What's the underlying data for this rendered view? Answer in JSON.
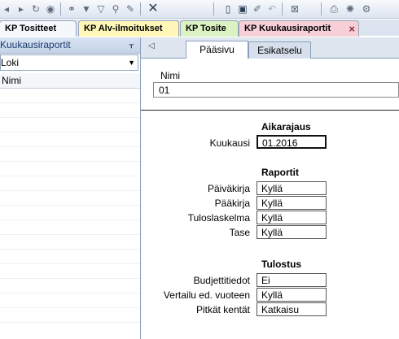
{
  "toolbar": {
    "icons": [
      "arrow-left-icon",
      "arrow-right-icon",
      "refresh-icon",
      "stop-icon",
      "binoculars-icon",
      "filter-icon",
      "filter-clear-icon",
      "zoom-icon",
      "clear-icon",
      "close-icon",
      "new-document-icon",
      "save-icon",
      "edit-icon",
      "undo-icon",
      "delete-icon",
      "print-icon",
      "settings-icon",
      "gear-icon"
    ]
  },
  "doc_tabs": [
    {
      "label": "KP Tositteet",
      "color": "#f5f7fb"
    },
    {
      "label": "KP Alv-ilmoitukset",
      "color": "#fff7b8"
    },
    {
      "label": "KP Tosite",
      "color": "#dcf2c4"
    },
    {
      "label": "KP Kuukausiraportit",
      "color": "#f7cfd7",
      "active": true,
      "close": "×"
    }
  ],
  "left_panel": {
    "title": "Kuukausiraportit",
    "pin": "ᚁ",
    "select_value": "Loki",
    "column_header": "Nimi"
  },
  "sub_tabs": [
    {
      "label": "Pääsivu",
      "active": true
    },
    {
      "label": "Esikatselu",
      "active": false
    }
  ],
  "form": {
    "name_label": "Nimi",
    "name_value": "01",
    "sections": {
      "aikarajaus": "Aikarajaus",
      "raportit": "Raportit",
      "tulostus": "Tulostus"
    },
    "kuukausi_label": "Kuukausi",
    "kuukausi_value": "01.2016",
    "raportit": [
      {
        "label": "Päiväkirja",
        "value": "Kyllä"
      },
      {
        "label": "Pääkirja",
        "value": "Kyllä"
      },
      {
        "label": "Tuloslaskelma",
        "value": "Kyllä"
      },
      {
        "label": "Tase",
        "value": "Kyllä"
      }
    ],
    "tulostus": [
      {
        "label": "Budjettitiedot",
        "value": "Ei"
      },
      {
        "label": "Vertailu ed. vuoteen",
        "value": "Kyllä"
      },
      {
        "label": "Pitkät kentät",
        "value": "Katkaisu"
      }
    ]
  }
}
